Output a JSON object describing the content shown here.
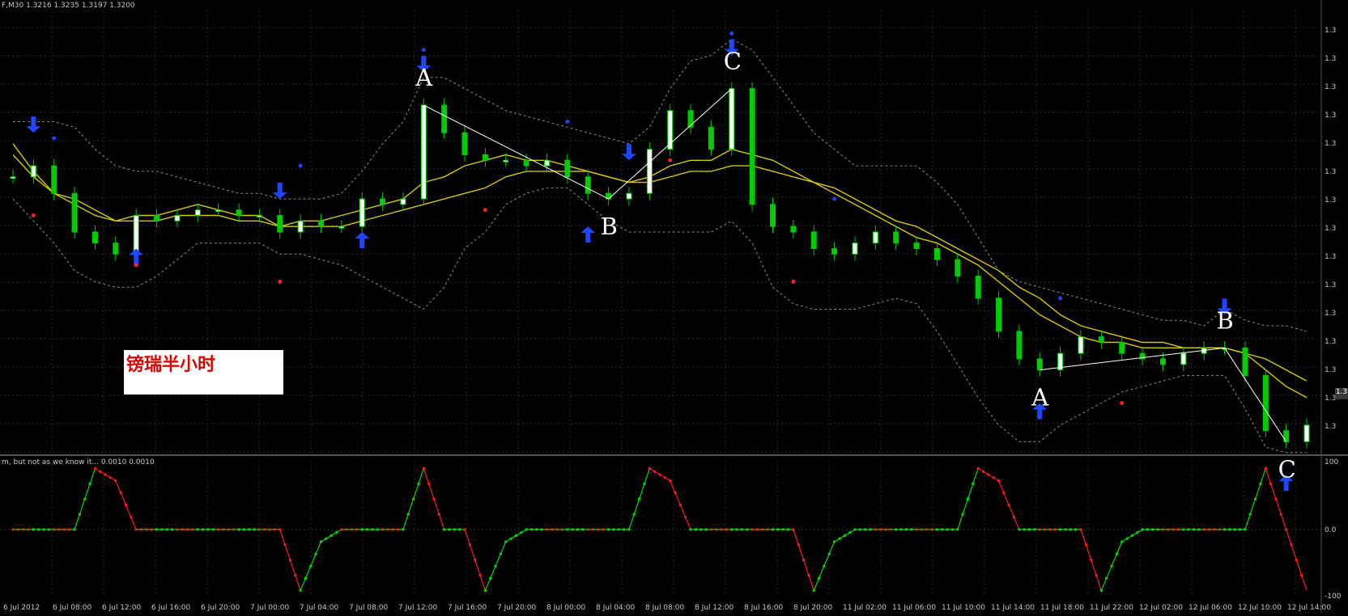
{
  "header": {
    "symbol_line": "F,M30  1.3216 1.3235 1.3197 1.3200",
    "indicator_line": "m, but not as we know it...  0.0010 0.0010"
  },
  "label_box": {
    "text": "镑瑞半小时"
  },
  "price_tag": "1.3",
  "annotations": [
    {
      "id": "A1",
      "text": "A",
      "i": 20
    },
    {
      "id": "B1",
      "text": "B",
      "i": 29
    },
    {
      "id": "C1",
      "text": "C",
      "i": 35
    },
    {
      "id": "A2",
      "text": "A",
      "i": 50
    },
    {
      "id": "B2",
      "text": "B",
      "i": 59
    },
    {
      "id": "C2",
      "text": "C",
      "i": 62
    }
  ],
  "x_ticks": [
    "6 Jul 2012",
    "6 Jul 08:00",
    "6 Jul 12:00",
    "6 Jul 16:00",
    "6 Jul 20:00",
    "7 Jul 00:00",
    "7 Jul 04:00",
    "7 Jul 08:00",
    "7 Jul 12:00",
    "7 Jul 16:00",
    "7 Jul 20:00",
    "8 Jul 00:00",
    "8 Jul 04:00",
    "8 Jul 08:00",
    "8 Jul 12:00",
    "8 Jul 16:00",
    "8 Jul 20:00",
    "11 Jul 02:00",
    "11 Jul 06:00",
    "11 Jul 10:00",
    "11 Jul 14:00",
    "11 Jul 18:00",
    "11 Jul 22:00",
    "12 Jul 02:00",
    "12 Jul 06:00",
    "12 Jul 10:00",
    "12 Jul 14:00"
  ],
  "y_ticks": [
    "1.3",
    "1.3",
    "1.3",
    "1.3",
    "1.3",
    "1.3",
    "1.3",
    "1.3",
    "1.3",
    "1.3",
    "1.3",
    "1.3",
    "1.3",
    "1.3",
    "1.3"
  ],
  "osc_ticks": [
    "100",
    "0.0",
    "-100"
  ],
  "colors": {
    "bull": "#ffffff",
    "bear": "#00cc00",
    "ma": "#d4c800",
    "band": "#8a8a8a",
    "grid": "#2b2b2b",
    "arrow": "#1e46ff",
    "dot_red": "#ff2020",
    "dot_blue": "#2040ff",
    "osc_up": "#00dd00",
    "osc_down": "#ff1a1a"
  },
  "chart_data": {
    "type": "candlestick",
    "title": "",
    "series": [
      {
        "name": "price",
        "values": [
          50,
          52,
          47,
          40,
          38,
          36,
          43,
          42,
          43,
          44,
          44,
          43,
          43,
          40,
          42,
          41,
          41,
          46,
          45,
          46,
          63,
          58,
          54,
          53,
          53,
          52,
          53,
          50,
          47,
          46,
          47,
          55,
          62,
          59,
          55,
          66,
          45,
          41,
          40,
          37,
          36,
          38,
          40,
          38,
          37,
          35,
          32,
          28,
          22,
          17,
          15,
          18,
          21,
          20,
          18,
          17,
          16,
          18,
          19,
          19,
          14,
          4,
          2,
          5
        ]
      },
      {
        "name": "ma_fast",
        "values": [
          56,
          51,
          47,
          46,
          44,
          42,
          43,
          43,
          44,
          45,
          44,
          43,
          43,
          41,
          42,
          42,
          43,
          44,
          45,
          46,
          49,
          50,
          52,
          53,
          54,
          53,
          53,
          52,
          51,
          50,
          49,
          50,
          52,
          53,
          53,
          55,
          54,
          53,
          51,
          49,
          47,
          45,
          43,
          41,
          39,
          38,
          36,
          34,
          31,
          28,
          25,
          23,
          21,
          20,
          20,
          19,
          19,
          19,
          19,
          19,
          18,
          15,
          12,
          10
        ]
      },
      {
        "name": "ma_slow",
        "values": [
          54,
          50,
          47,
          45,
          43,
          42,
          42,
          42,
          43,
          43,
          43,
          42,
          42,
          41,
          41,
          41,
          41,
          42,
          43,
          44,
          45,
          46,
          47,
          48,
          50,
          51,
          51,
          51,
          51,
          50,
          49,
          49,
          50,
          51,
          51,
          52,
          52,
          51,
          50,
          49,
          48,
          46,
          44,
          42,
          41,
          39,
          37,
          35,
          33,
          30,
          28,
          25,
          23,
          22,
          21,
          20,
          20,
          19,
          19,
          19,
          18,
          17,
          15,
          13
        ]
      },
      {
        "name": "band_upper",
        "values": [
          60,
          60,
          60,
          59,
          55,
          52,
          51,
          51,
          50,
          49,
          48,
          47,
          47,
          46,
          46,
          46,
          47,
          51,
          56,
          60,
          68,
          68,
          66,
          64,
          62,
          61,
          60,
          59,
          58,
          57,
          56,
          59,
          66,
          71,
          72,
          75,
          73,
          68,
          63,
          58,
          55,
          52,
          52,
          52,
          52,
          49,
          45,
          39,
          33,
          31,
          30,
          29,
          28,
          27,
          26,
          25,
          24,
          24,
          23,
          26,
          24,
          23,
          23,
          22
        ]
      },
      {
        "name": "band_lower",
        "values": [
          46,
          42,
          38,
          33,
          31,
          30,
          30,
          32,
          35,
          38,
          38,
          38,
          38,
          36,
          36,
          35,
          34,
          32,
          30,
          28,
          26,
          30,
          37,
          40,
          45,
          47,
          48,
          48,
          45,
          42,
          40,
          40,
          40,
          40,
          40,
          42,
          38,
          30,
          27,
          26,
          26,
          26,
          27,
          28,
          27,
          22,
          16,
          10,
          5,
          2,
          2,
          5,
          7,
          9,
          11,
          12,
          13,
          14,
          14,
          14,
          8,
          1,
          0,
          0
        ]
      },
      {
        "name": "oscillator",
        "values": [
          0,
          0,
          0,
          0,
          100,
          80,
          0,
          0,
          0,
          0,
          0,
          0,
          0,
          0,
          -100,
          -20,
          0,
          0,
          0,
          0,
          100,
          0,
          0,
          -100,
          -20,
          0,
          0,
          0,
          0,
          0,
          0,
          100,
          80,
          0,
          0,
          0,
          0,
          0,
          0,
          -100,
          -20,
          0,
          0,
          0,
          0,
          0,
          0,
          100,
          80,
          0,
          0,
          0,
          0,
          -100,
          -20,
          0,
          0,
          0,
          0,
          0,
          0,
          100,
          0,
          -100
        ]
      }
    ],
    "arrows_down": [
      1,
      13,
      20,
      30,
      35,
      59
    ],
    "arrows_up": [
      6,
      17,
      28,
      50,
      62
    ],
    "dots_red": [
      1,
      6,
      13,
      23,
      32,
      38,
      54
    ],
    "dots_blue": [
      2,
      14,
      20,
      27,
      35,
      40,
      51
    ],
    "ylim": [
      0,
      80
    ],
    "osc_ylim": [
      -110,
      110
    ],
    "osc_y_labels": [
      "100",
      "0.0",
      "-100"
    ]
  }
}
